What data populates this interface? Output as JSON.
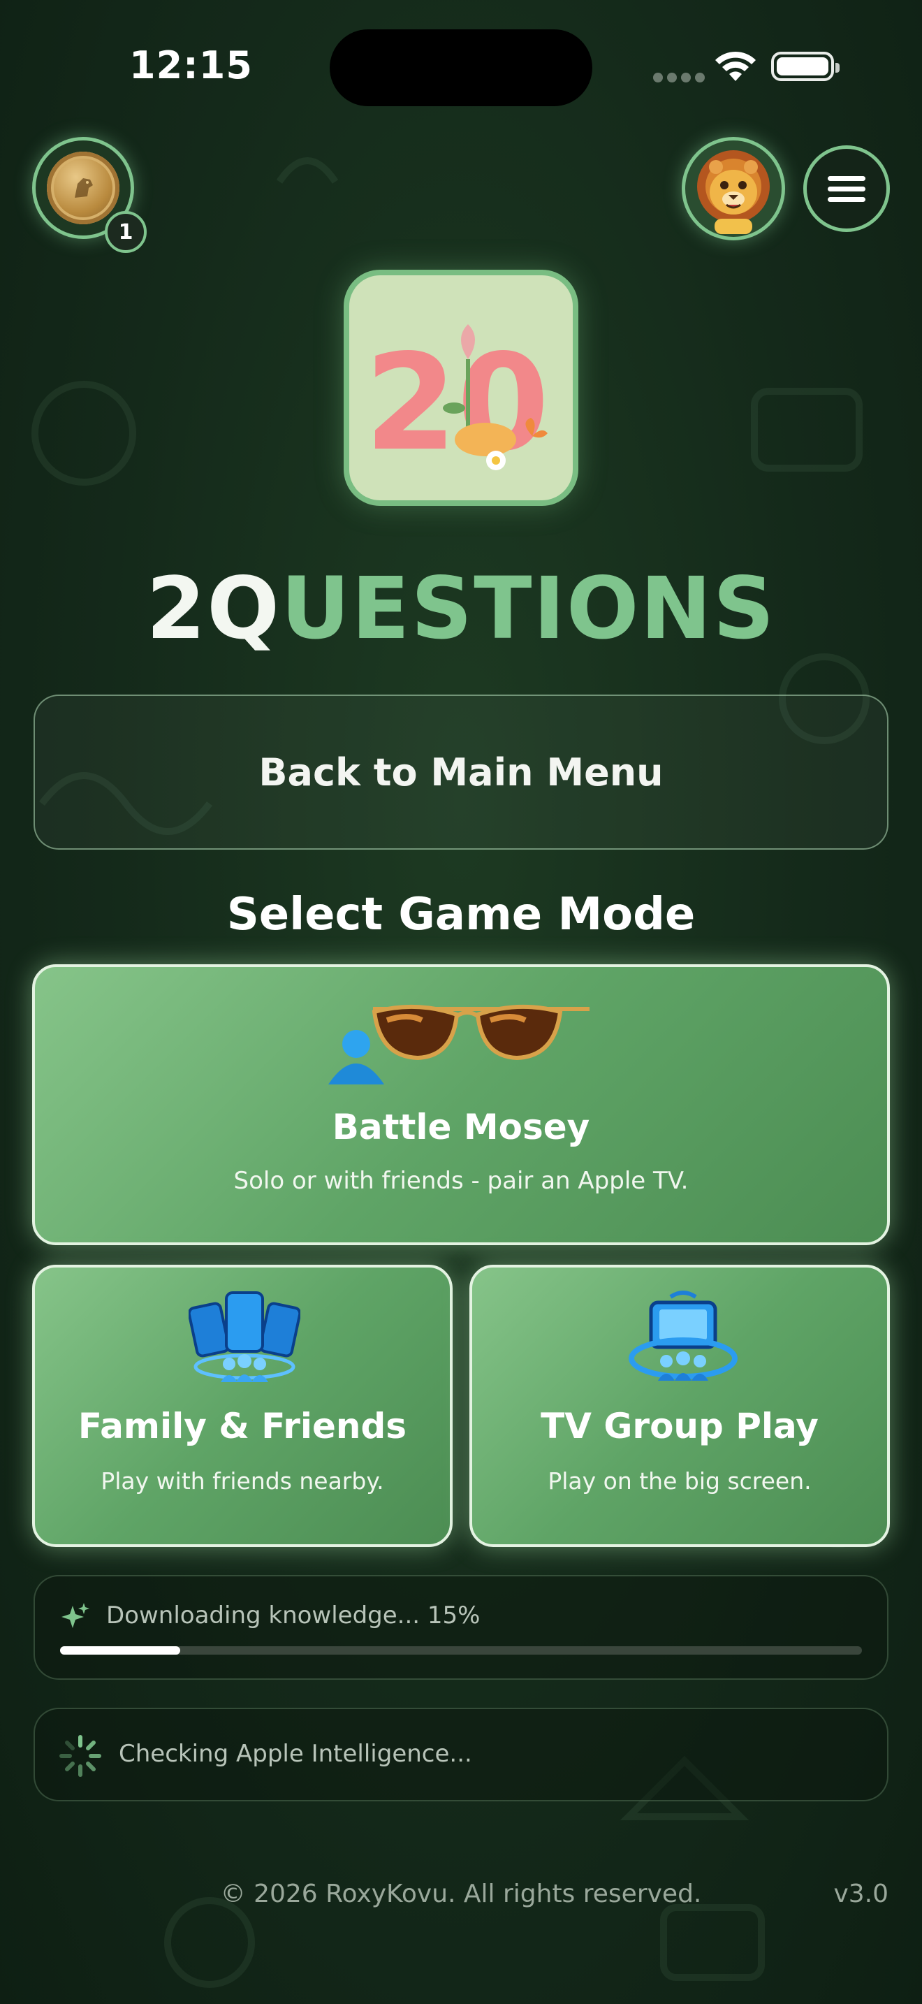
{
  "status_bar": {
    "time": "12:15"
  },
  "coins": {
    "count": "1",
    "icon": "coin-icon"
  },
  "profile": {
    "icon": "lion-avatar-icon"
  },
  "menu": {
    "icon": "hamburger-icon"
  },
  "logo": {
    "text": "20"
  },
  "brand": {
    "part1": "2Q",
    "part2": "UESTIONS"
  },
  "back_button": {
    "label": "Back to Main Menu"
  },
  "section": {
    "title": "Select Game Mode"
  },
  "modes": [
    {
      "title": "Battle Mosey",
      "subtitle": "Solo or with friends - pair an Apple TV.",
      "icon": "sunglasses-person-icon"
    },
    {
      "title": "Family & Friends",
      "subtitle": "Play with friends nearby.",
      "icon": "phones-group-icon"
    },
    {
      "title": "TV Group Play",
      "subtitle": "Play on the big screen.",
      "icon": "tv-group-icon"
    }
  ],
  "download": {
    "label": "Downloading knowledge... 15%",
    "progress": 0.15
  },
  "intelligence": {
    "label": "Checking Apple Intelligence..."
  },
  "footer": {
    "copyright": "© 2026 RoxyKovu. All rights reserved.",
    "version": "v3.0"
  },
  "colors": {
    "accent": "#7fc48d",
    "background": "#14291a",
    "card": "#5fa466"
  }
}
